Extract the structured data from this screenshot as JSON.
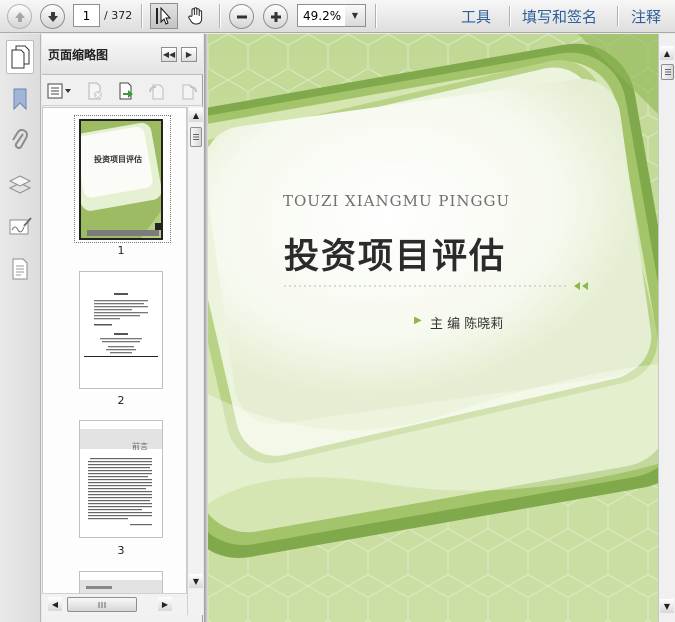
{
  "toolbar": {
    "current_page": "1",
    "total_pages": "/ 372",
    "zoom": "49.2%",
    "menu": {
      "tools": "工具",
      "fill_sign": "填写和签名",
      "comment": "注释"
    }
  },
  "panel": {
    "title": "页面缩略图"
  },
  "thumbnails": [
    {
      "num": "1",
      "cover_title": "投资项目评估"
    },
    {
      "num": "2"
    },
    {
      "num": "3",
      "heading": "前言"
    }
  ],
  "document": {
    "subtitle": "TOUZI XIANGMU PINGGU",
    "title": "投资项目评估",
    "author": "主  编   陈晓莉"
  },
  "icons": {
    "prev_page": "arrow-up-icon",
    "next_page": "arrow-down-icon",
    "select": "cursor-icon",
    "hand": "hand-icon",
    "zoom_out": "minus-icon",
    "zoom_in": "plus-icon"
  },
  "colors": {
    "accent_green": "#8cb84a",
    "link_blue": "#2d5f9a"
  }
}
